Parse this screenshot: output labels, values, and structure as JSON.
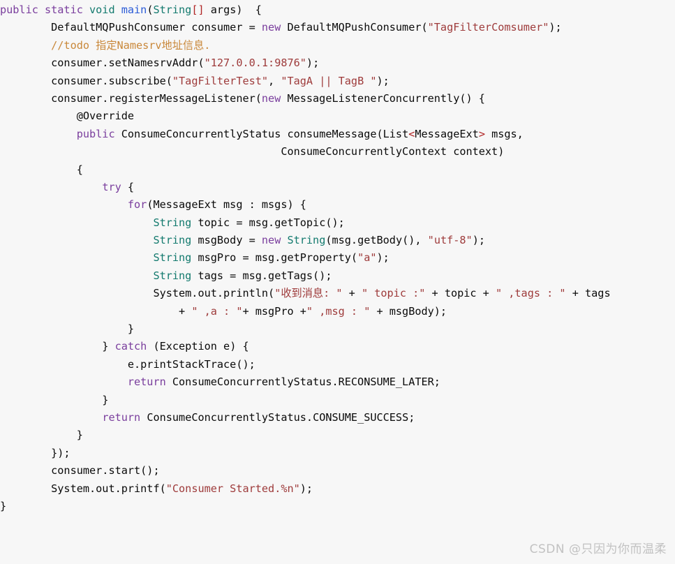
{
  "editor": {
    "background_color": "#f7f7f7",
    "language": "java",
    "font_size_px": 15,
    "line_height_px": 25
  },
  "colors": {
    "default": "#0a0a0a",
    "keyword": "#7a3e9d",
    "type": "#137a6e",
    "method": "#2b5bd7",
    "string": "#9e3b3b",
    "comment": "#c9883a",
    "annotation": "#8a8a8a",
    "bracket": "#b02525",
    "watermark": "#c2c2c2"
  },
  "watermark": {
    "text": "CSDN @只因为你而温柔"
  },
  "code": {
    "lines": [
      [
        {
          "t": "public static ",
          "c": "keyword"
        },
        {
          "t": "void ",
          "c": "type"
        },
        {
          "t": "main",
          "c": "method"
        },
        {
          "t": "(",
          "c": "default"
        },
        {
          "t": "String",
          "c": "type"
        },
        {
          "t": "[]",
          "c": "bracket"
        },
        {
          "t": " args)  {",
          "c": "default"
        }
      ],
      [
        {
          "t": "        DefaultMQPushConsumer consumer = ",
          "c": "default"
        },
        {
          "t": "new ",
          "c": "keyword"
        },
        {
          "t": "DefaultMQPushConsumer(",
          "c": "default"
        },
        {
          "t": "\"TagFilterComsumer\"",
          "c": "string"
        },
        {
          "t": ");",
          "c": "default"
        }
      ],
      [
        {
          "t": "        //todo 指定Namesrv地址信息.",
          "c": "comment"
        }
      ],
      [
        {
          "t": "        consumer.setNamesrvAddr(",
          "c": "default"
        },
        {
          "t": "\"127.0.0.1:9876\"",
          "c": "string"
        },
        {
          "t": ");",
          "c": "default"
        }
      ],
      [
        {
          "t": "        consumer.subscribe(",
          "c": "default"
        },
        {
          "t": "\"TagFilterTest\"",
          "c": "string"
        },
        {
          "t": ", ",
          "c": "default"
        },
        {
          "t": "\"TagA || TagB \"",
          "c": "string"
        },
        {
          "t": ");",
          "c": "default"
        }
      ],
      [
        {
          "t": "        consumer.registerMessageListener(",
          "c": "default"
        },
        {
          "t": "new ",
          "c": "keyword"
        },
        {
          "t": "MessageListenerConcurrently() {",
          "c": "default"
        }
      ],
      [
        {
          "t": "            @Override",
          "c": "annotation"
        }
      ],
      [
        {
          "t": "            ",
          "c": "default"
        },
        {
          "t": "public ",
          "c": "keyword"
        },
        {
          "t": "ConsumeConcurrentlyStatus consumeMessage(List",
          "c": "default"
        },
        {
          "t": "<",
          "c": "bracket"
        },
        {
          "t": "MessageExt",
          "c": "default"
        },
        {
          "t": ">",
          "c": "bracket"
        },
        {
          "t": " msgs,",
          "c": "default"
        }
      ],
      [
        {
          "t": "                                            ConsumeConcurrentlyContext context)",
          "c": "default"
        }
      ],
      [
        {
          "t": "            {",
          "c": "default"
        }
      ],
      [
        {
          "t": "                ",
          "c": "default"
        },
        {
          "t": "try ",
          "c": "keyword"
        },
        {
          "t": "{",
          "c": "default"
        }
      ],
      [
        {
          "t": "                    ",
          "c": "default"
        },
        {
          "t": "for",
          "c": "keyword"
        },
        {
          "t": "(MessageExt msg : msgs) {",
          "c": "default"
        }
      ],
      [
        {
          "t": "                        ",
          "c": "default"
        },
        {
          "t": "String ",
          "c": "type"
        },
        {
          "t": "topic = msg.getTopic();",
          "c": "default"
        }
      ],
      [
        {
          "t": "                        ",
          "c": "default"
        },
        {
          "t": "String ",
          "c": "type"
        },
        {
          "t": "msgBody = ",
          "c": "default"
        },
        {
          "t": "new ",
          "c": "keyword"
        },
        {
          "t": "String",
          "c": "type"
        },
        {
          "t": "(msg.getBody(), ",
          "c": "default"
        },
        {
          "t": "\"utf-8\"",
          "c": "string"
        },
        {
          "t": ");",
          "c": "default"
        }
      ],
      [
        {
          "t": "                        ",
          "c": "default"
        },
        {
          "t": "String ",
          "c": "type"
        },
        {
          "t": "msgPro = msg.getProperty(",
          "c": "default"
        },
        {
          "t": "\"a\"",
          "c": "string"
        },
        {
          "t": ");",
          "c": "default"
        }
      ],
      [
        {
          "t": "                        ",
          "c": "default"
        },
        {
          "t": "String ",
          "c": "type"
        },
        {
          "t": "tags = msg.getTags();",
          "c": "default"
        }
      ],
      [
        {
          "t": "                        System.out.println(",
          "c": "default"
        },
        {
          "t": "\"收到消息: \"",
          "c": "string"
        },
        {
          "t": " + ",
          "c": "default"
        },
        {
          "t": "\" topic :\"",
          "c": "string"
        },
        {
          "t": " + topic + ",
          "c": "default"
        },
        {
          "t": "\" ,tags : \"",
          "c": "string"
        },
        {
          "t": " + tags",
          "c": "default"
        }
      ],
      [
        {
          "t": "                            + ",
          "c": "default"
        },
        {
          "t": "\" ,a : \"",
          "c": "string"
        },
        {
          "t": "+ msgPro +",
          "c": "default"
        },
        {
          "t": "\" ,msg : \"",
          "c": "string"
        },
        {
          "t": " + msgBody);",
          "c": "default"
        }
      ],
      [
        {
          "t": "                    }",
          "c": "default"
        }
      ],
      [
        {
          "t": "                } ",
          "c": "default"
        },
        {
          "t": "catch ",
          "c": "keyword"
        },
        {
          "t": "(Exception e) {",
          "c": "default"
        }
      ],
      [
        {
          "t": "                    e.printStackTrace();",
          "c": "default"
        }
      ],
      [
        {
          "t": "                    ",
          "c": "default"
        },
        {
          "t": "return ",
          "c": "keyword"
        },
        {
          "t": "ConsumeConcurrentlyStatus.RECONSUME_LATER;",
          "c": "default"
        }
      ],
      [
        {
          "t": "                }",
          "c": "default"
        }
      ],
      [
        {
          "t": "                ",
          "c": "default"
        },
        {
          "t": "return ",
          "c": "keyword"
        },
        {
          "t": "ConsumeConcurrentlyStatus.CONSUME_SUCCESS;",
          "c": "default"
        }
      ],
      [
        {
          "t": "            }",
          "c": "default"
        }
      ],
      [
        {
          "t": "        });",
          "c": "default"
        }
      ],
      [
        {
          "t": "        consumer.start();",
          "c": "default"
        }
      ],
      [
        {
          "t": "        System.out.printf(",
          "c": "default"
        },
        {
          "t": "\"Consumer Started.%n\"",
          "c": "string"
        },
        {
          "t": ");",
          "c": "default"
        }
      ],
      [
        {
          "t": "}",
          "c": "default"
        }
      ]
    ]
  }
}
